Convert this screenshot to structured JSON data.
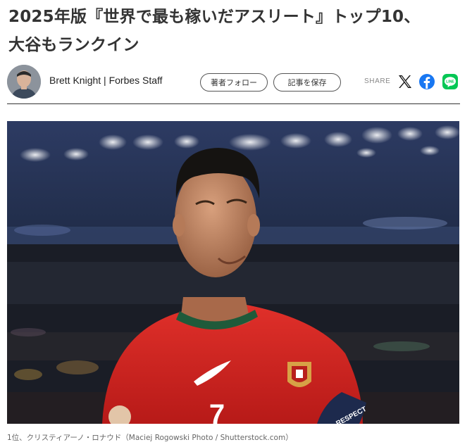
{
  "article": {
    "title_line1": "2025年版『世界で最も稼いだアスリート』トップ10、",
    "title_line2": "大谷もランクイン"
  },
  "byline": {
    "author": "Brett Knight | Forbes Staff",
    "follow_label": "著者フォロー",
    "save_label": "記事を保存",
    "share_label": "SHARE",
    "social_icons": [
      "x-icon",
      "facebook-icon",
      "line-icon"
    ],
    "line_badge_text": "LINE"
  },
  "image": {
    "caption": "1位、クリスティアーノ・ロナウド（Maciej Rogowski Photo / Shutterstock.com）",
    "jersey_number": "7",
    "armband_text": "RESPECT"
  },
  "colors": {
    "facebook": "#1877f2",
    "line": "#06c755",
    "jersey_red": "#d8221f",
    "collar_green": "#1f5a3a"
  }
}
